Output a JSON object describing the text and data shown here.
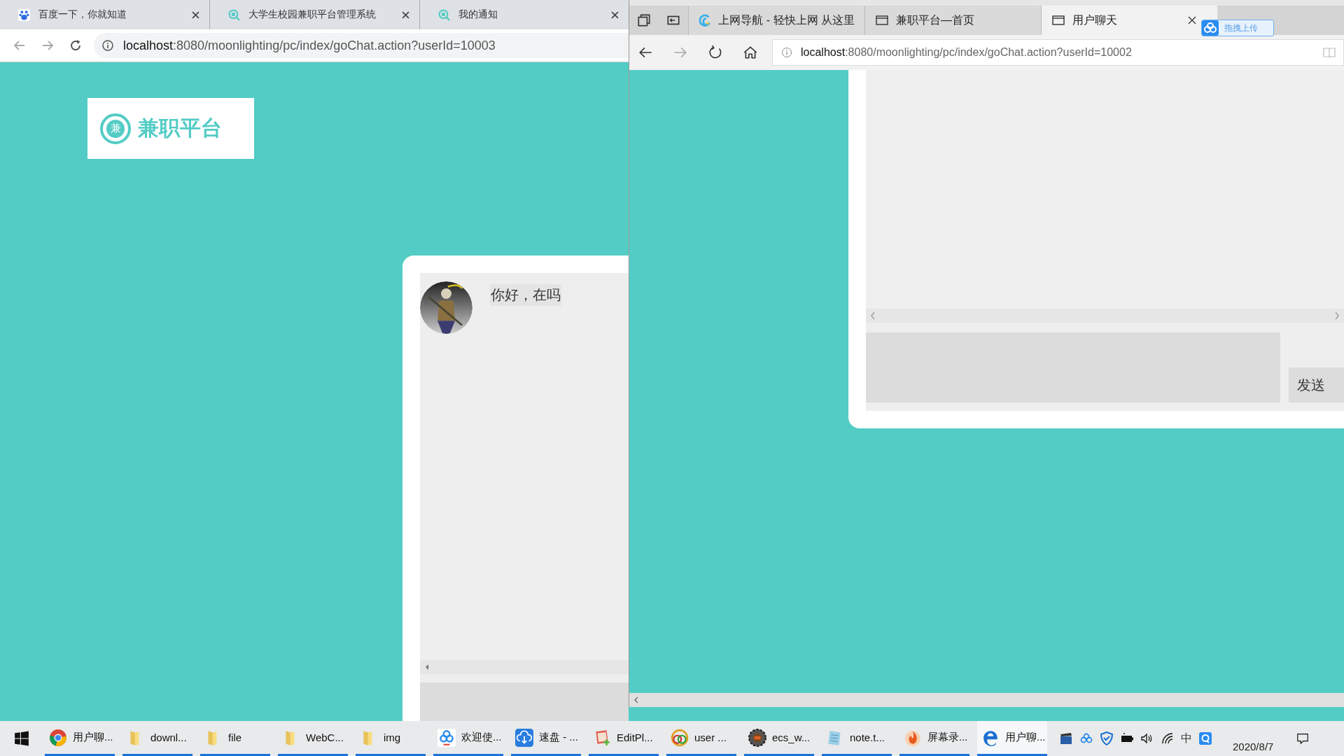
{
  "left_browser": {
    "tabs": [
      {
        "title": "百度一下，你就知道",
        "kind": "paw"
      },
      {
        "title": "大学生校园兼职平台管理系统",
        "kind": "search"
      },
      {
        "title": "我的通知",
        "kind": "search"
      }
    ],
    "url_host": "localhost",
    "url_rest": ":8080/moonlighting/pc/index/goChat.action?userId=10003",
    "logo_mark": "兼",
    "logo_text": "兼职平台",
    "messages": [
      {
        "text": "你好，在吗"
      }
    ]
  },
  "right_browser": {
    "tabs": [
      {
        "title": "上网导航 - 轻快上网 从这里",
        "kind": "swirl",
        "selected": false
      },
      {
        "title": "兼职平台—首页",
        "kind": "page",
        "selected": false
      },
      {
        "title": "用户聊天",
        "kind": "page",
        "selected": true
      }
    ],
    "url_host": "localhost",
    "url_rest": ":8080/moonlighting/pc/index/goChat.action?userId=10002",
    "send_button": "发送"
  },
  "upload_widget": "拖拽上传",
  "taskbar": {
    "items": [
      {
        "label": "用户聊...",
        "kind": "chrome",
        "selected": false
      },
      {
        "label": "downl...",
        "kind": "folder",
        "selected": false
      },
      {
        "label": "file",
        "kind": "folder",
        "selected": false
      },
      {
        "label": "WebC...",
        "kind": "folder",
        "selected": false
      },
      {
        "label": "img",
        "kind": "folder",
        "selected": false
      },
      {
        "label": "欢迎使...",
        "kind": "baidu",
        "selected": false
      },
      {
        "label": "速盘 - ...",
        "kind": "cloud",
        "selected": false
      },
      {
        "label": "EditPl...",
        "kind": "editor",
        "selected": false
      },
      {
        "label": "user ...",
        "kind": "rings",
        "selected": false
      },
      {
        "label": "ecs_w...",
        "kind": "gear",
        "selected": false
      },
      {
        "label": "note.t...",
        "kind": "note",
        "selected": false
      },
      {
        "label": "屏幕录...",
        "kind": "flame",
        "selected": false
      },
      {
        "label": "用户聊...",
        "kind": "edge",
        "selected": true
      }
    ],
    "ime": "中",
    "date": "2020/8/7"
  }
}
